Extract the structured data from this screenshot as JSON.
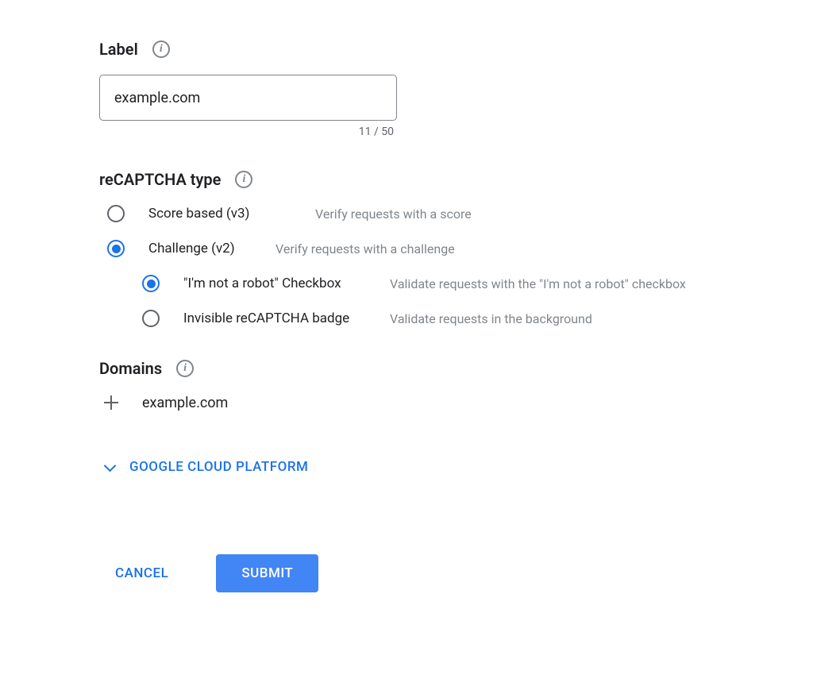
{
  "label": {
    "title": "Label",
    "value": "example.com",
    "charCount": "11 / 50"
  },
  "recaptchaType": {
    "title": "reCAPTCHA type",
    "options": [
      {
        "label": "Score based (v3)",
        "description": "Verify requests with a score",
        "selected": false
      },
      {
        "label": "Challenge (v2)",
        "description": "Verify requests with a challenge",
        "selected": true,
        "subOptions": [
          {
            "label": "\"I'm not a robot\" Checkbox",
            "description": "Validate requests with the \"I'm not a robot\" checkbox",
            "selected": true
          },
          {
            "label": "Invisible reCAPTCHA badge",
            "description": "Validate requests in the background",
            "selected": false
          }
        ]
      }
    ]
  },
  "domains": {
    "title": "Domains",
    "items": [
      "example.com"
    ]
  },
  "expandSection": {
    "label": "GOOGLE CLOUD PLATFORM"
  },
  "buttons": {
    "cancel": "CANCEL",
    "submit": "SUBMIT"
  }
}
